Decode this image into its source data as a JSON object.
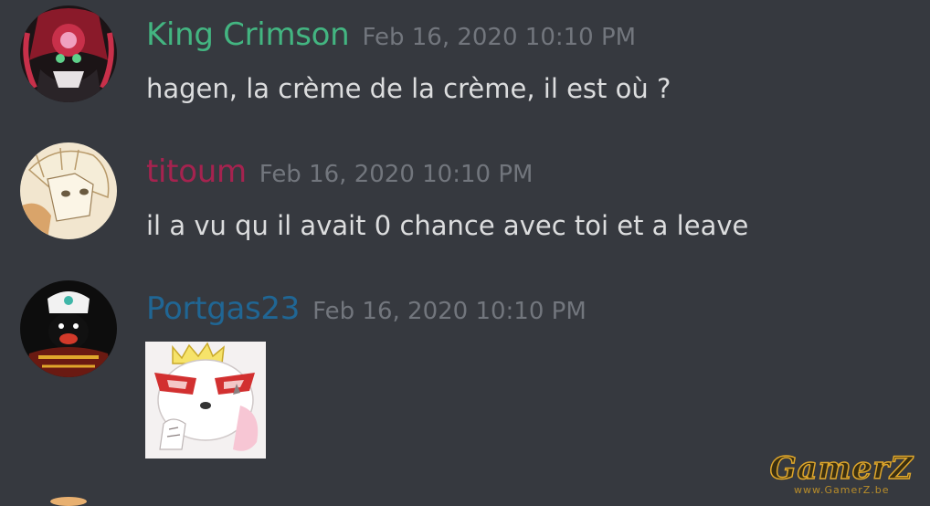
{
  "messages": [
    {
      "username": "King Crimson",
      "username_color": "#43b581",
      "timestamp": "Feb 16, 2020 10:10 PM",
      "text": "hagen, la crème de la crème, il est où ?",
      "avatar": "king-crimson-avatar"
    },
    {
      "username": "titoum",
      "username_color": "#a5234f",
      "timestamp": "Feb 16, 2020 10:10 PM",
      "text": "il a vu qu il avait 0 chance avec toi et a leave",
      "avatar": "titoum-avatar"
    },
    {
      "username": "Portgas23",
      "username_color": "#206694",
      "timestamp": "Feb 16, 2020 10:10 PM",
      "text": "",
      "avatar": "portgas23-avatar",
      "attachment": "sticker-image"
    }
  ],
  "watermark": {
    "logo": "GamerZ",
    "url": "www.GamerZ.be"
  },
  "theme": {
    "background": "#36393f",
    "text": "#dcddde",
    "timestamp": "#72767d"
  }
}
